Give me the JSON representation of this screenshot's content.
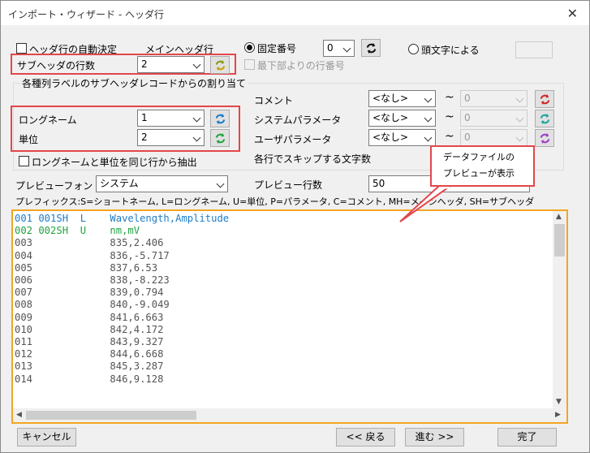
{
  "window": {
    "title": "インポート・ウィザード - ヘッダ行"
  },
  "header": {
    "auto_detect_label": "ヘッダ行の自動決定",
    "main_header_label": "メインヘッダ行",
    "fixed_number_label": "固定番号",
    "fixed_number_value": "0",
    "bottom_row_label": "最下部よりの行番号",
    "leading_char_label": "頭文字による",
    "subheader_count_label": "サブヘッダの行数",
    "subheader_count_value": "2"
  },
  "assign": {
    "group_label": "各種列ラベルのサブヘッダレコードからの割り当て",
    "longname_label": "ロングネーム",
    "longname_value": "1",
    "unit_label": "単位",
    "unit_value": "2",
    "comment_label": "コメント",
    "comment_value": "<なし>",
    "comment_to": "0",
    "sysparam_label": "システムパラメータ",
    "sysparam_value": "<なし>",
    "sysparam_to": "0",
    "userparam_label": "ユーザパラメータ",
    "userparam_value": "<なし>",
    "userparam_to": "0",
    "tilde": "~",
    "same_row_label": "ロングネームと単位を同じ行から抽出",
    "skip_chars_label": "各行でスキップする文字数"
  },
  "preview_opts": {
    "font_label": "プレビューフォント",
    "font_value": "システム",
    "rows_label": "プレビュー行数",
    "rows_value": "50",
    "prefix_legend": "プレフィックス:S=ショートネーム, L=ロングネーム, U=単位, P=パラメータ, C=コメント, MH=メインヘッダ, SH=サブヘッダ"
  },
  "callout": {
    "line1": "データファイルの",
    "line2": "プレビューが表示"
  },
  "preview_lines": [
    {
      "text": "001 001SH  L    Wavelength,Amplitude",
      "kind": "short"
    },
    {
      "text": "002 002SH  U    nm,mV",
      "kind": "unit"
    },
    {
      "text": "003             835,2.406",
      "kind": "data"
    },
    {
      "text": "004             836,-5.717",
      "kind": "data"
    },
    {
      "text": "005             837,6.53",
      "kind": "data"
    },
    {
      "text": "006             838,-8.223",
      "kind": "data"
    },
    {
      "text": "007             839,0.794",
      "kind": "data"
    },
    {
      "text": "008             840,-9.049",
      "kind": "data"
    },
    {
      "text": "009             841,6.663",
      "kind": "data"
    },
    {
      "text": "010             842,4.172",
      "kind": "data"
    },
    {
      "text": "011             843,9.327",
      "kind": "data"
    },
    {
      "text": "012             844,6.668",
      "kind": "data"
    },
    {
      "text": "013             845,3.287",
      "kind": "data"
    },
    {
      "text": "014             846,9.128",
      "kind": "data"
    }
  ],
  "buttons": {
    "cancel": "キャンセル",
    "back": "<< 戻る",
    "next": "進む >>",
    "finish": "完了"
  },
  "colors": {
    "highlight": "#e2474b",
    "preview_border": "#f2a623",
    "short_line": "#1e7dc8",
    "unit_line": "#21a340"
  }
}
